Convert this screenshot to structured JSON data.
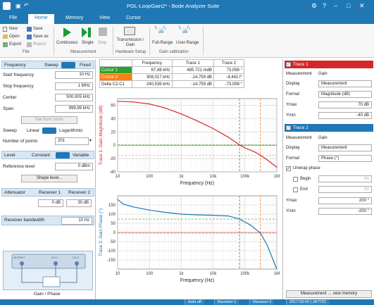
{
  "window": {
    "title": "POL-LoopGain2* - Bode Analyzer Suite"
  },
  "ribbon_tabs": [
    "File",
    "Home",
    "Memory",
    "View",
    "Cursor"
  ],
  "ribbon": {
    "file_items": [
      "New",
      "Save",
      "Open",
      "Save as",
      "Export",
      "Report"
    ],
    "file_label": "File",
    "measurement_items": [
      "Continuous",
      "Single",
      "Stop"
    ],
    "measurement_label": "Measurement",
    "hardware_item": "Transmission / Gain",
    "hardware_label": "Hardware Setup",
    "gain_items": [
      "Full-Range",
      "User-Range"
    ],
    "gain_icon_text": [
      "dB",
      "dB"
    ],
    "gain_label": "Gain calibration"
  },
  "left": {
    "tabs": [
      "Frequency",
      "Sweep"
    ],
    "fixed_label": "Fixed",
    "start_label": "Start frequency",
    "start_value": "10 Hz",
    "stop_label": "Stop frequency",
    "stop_value": "1 MHz",
    "center_label": "Center",
    "center_value": "500,005 kHz",
    "span_label": "Span",
    "span_value": "999,99 kHz",
    "get_zoom_label": "Get from zoom",
    "sweep_label": "Sweep",
    "linear_label": "Linear",
    "log_label": "Logarithmic",
    "points_label": "Number of points",
    "points_value": "201",
    "level_tab": "Level",
    "constant_label": "Constant",
    "variable_label": "Variable",
    "ref_level_label": "Reference level",
    "ref_level_value": "0 dBm",
    "shape_level_label": "Shape level...",
    "attenuator_label": "Attenuator",
    "receiver1_label": "Receiver 1",
    "receiver2_label": "Receiver 2",
    "att1_value": "0 dB",
    "att2_value": "30 dB",
    "rbw_label": "Receiver bandwidth",
    "rbw_value": "10 Hz",
    "diagram_caption": "Gain / Phase",
    "diagram_labels": [
      "OUTPUT",
      "CH 1",
      "CH 2"
    ]
  },
  "cursor_table": {
    "headers": [
      "",
      "Frequency",
      "Trace 1",
      "Trace 2"
    ],
    "rows": [
      [
        "Cursor 1",
        "67,48 kHz",
        "485.721 mdB",
        "73,098 °"
      ],
      [
        "Cursor 2",
        "308,017 kHz",
        "-14,759 dB",
        "-4,441 f°"
      ],
      [
        "Delta C2-C1",
        "240,539 kHz",
        "-14,759 dB",
        "-73,098 °"
      ]
    ]
  },
  "chart_data": [
    {
      "type": "line",
      "title": "",
      "xlabel": "Frequency (Hz)",
      "ylabel": "Trace 1: Gain Magnitude (dB)",
      "x_scale": "log",
      "xlim": [
        10,
        1000000
      ],
      "ylim": [
        -40,
        70
      ],
      "xticks": [
        "10",
        "100",
        "1k",
        "10k",
        "100k",
        "1M"
      ],
      "yticks": [
        "60",
        "40",
        "20",
        "0",
        "-20",
        "-40"
      ],
      "grid": true,
      "series": [
        {
          "x": [
            10,
            30,
            100,
            300,
            1000,
            3000,
            10000,
            30000,
            67480,
            100000,
            200000,
            308017,
            500000,
            1000000
          ],
          "y": [
            66,
            65,
            62,
            56,
            47,
            37,
            25,
            12,
            0.5,
            -4,
            -10,
            -15,
            -22,
            -33
          ]
        }
      ],
      "cursor_x": [
        67480,
        308017
      ]
    },
    {
      "type": "line",
      "title": "",
      "xlabel": "Frequency (Hz)",
      "ylabel": "Trace 2: Gain Phase (°)",
      "x_scale": "log",
      "xlim": [
        10,
        1000000
      ],
      "ylim": [
        -200,
        200
      ],
      "xticks": [
        "10",
        "100",
        "1k",
        "10k",
        "100k",
        "1M"
      ],
      "yticks": [
        "150",
        "100",
        "50",
        "0",
        "-50",
        "-100",
        "-150"
      ],
      "grid": true,
      "series": [
        {
          "x": [
            10,
            15,
            30,
            100,
            300,
            1000,
            3000,
            10000,
            30000,
            67480,
            150000,
            308017,
            500000,
            1000000
          ],
          "y": [
            180,
            155,
            140,
            122,
            110,
            100,
            96,
            94,
            90,
            73,
            40,
            -4,
            -70,
            -200
          ]
        }
      ],
      "cursor_x": [
        67480,
        308017
      ]
    }
  ],
  "right": {
    "trace1_title": "Trace 1",
    "trace1_measurement_label": "Measurement",
    "trace1_measurement_value": "Gain",
    "trace1_display_label": "Display",
    "trace1_display_value": "Measurement",
    "trace1_format_label": "Format",
    "trace1_format_value": "Magnitude (dB)",
    "trace1_ymax_label": "Ymax",
    "trace1_ymax_value": "70 dB",
    "trace1_ymin_label": "Ymin",
    "trace1_ymin_value": "-40 dB",
    "trace2_title": "Trace 2",
    "trace2_measurement_label": "Measurement",
    "trace2_measurement_value": "Gain",
    "trace2_display_label": "Display",
    "trace2_display_value": "Measurement",
    "trace2_format_label": "Format",
    "trace2_format_value": "Phase (°)",
    "unwrap_label": "Unwrap phase",
    "begin_label": "Begin",
    "begin_value": "Hz",
    "end_label": "End",
    "end_value": "Hz",
    "trace2_ymax_label": "Ymax",
    "trace2_ymax_value": "200 °",
    "trace2_ymin_label": "Ymin",
    "trace2_ymin_value": "-200 °",
    "memory_button": "Measurement → new memory"
  },
  "status": {
    "items": [
      "Auto off",
      "Receiver 1",
      "Receiver 2",
      "2017-03-02 | JA7T2C"
    ]
  },
  "colors": {
    "accent": "#1f78b4",
    "trace1": "#d62728",
    "trace2": "#1f77b4",
    "cursor1": "#2ca02c",
    "cursor2": "#ff7f0e"
  }
}
